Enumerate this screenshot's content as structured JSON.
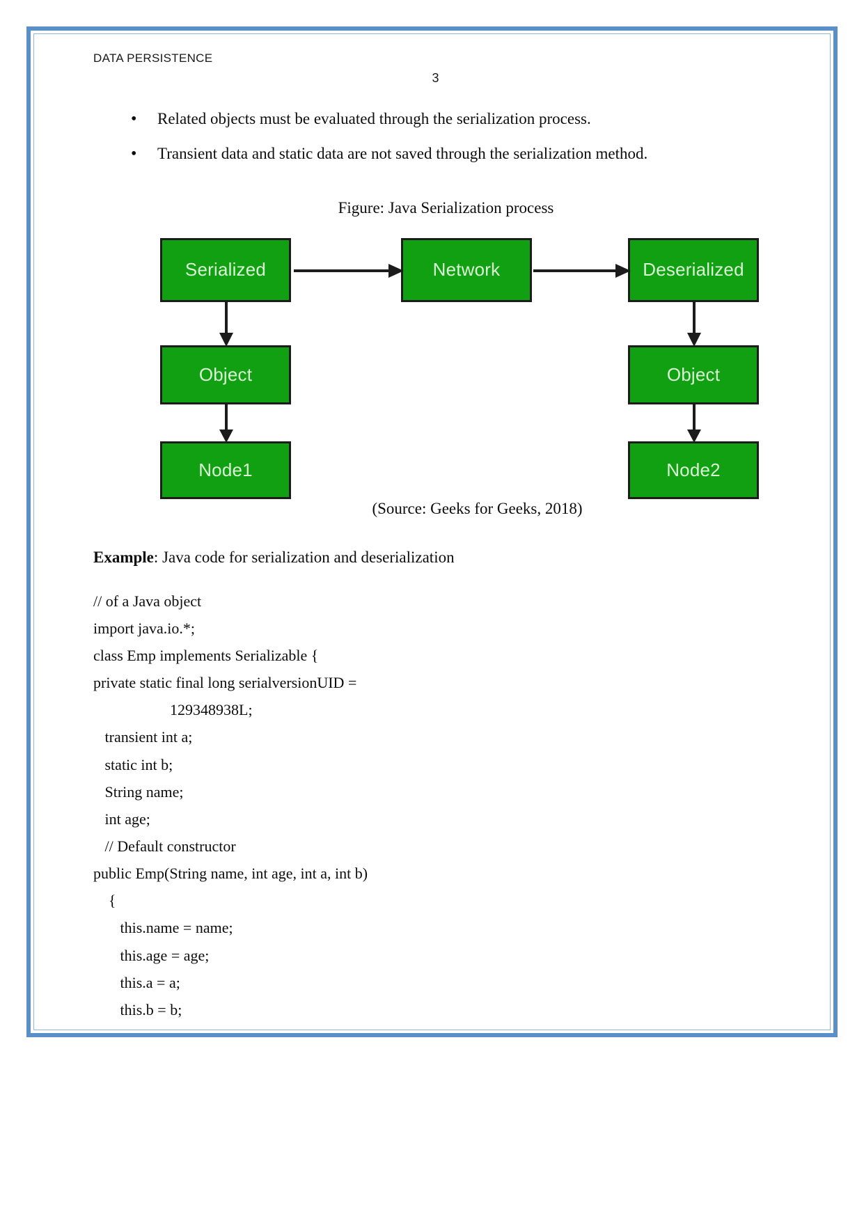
{
  "document": {
    "header": "DATA PERSISTENCE",
    "page_number": "3"
  },
  "bullets": [
    {
      "marker": "•",
      "text": "Related objects must be evaluated through the serialization process."
    },
    {
      "marker": "•",
      "text": "Transient data and static data are not saved through the serialization method."
    }
  ],
  "figure": {
    "caption": "Figure: Java Serialization process",
    "source": "(Source: Geeks for Geeks, 2018)",
    "box_fill": "#10a011",
    "box_border": "#1c1c1c",
    "box_text_color": "#d9f5d6",
    "nodes": {
      "serialized": "Serialized",
      "network": "Network",
      "deserialized": "Deserialized",
      "object_left": "Object",
      "object_right": "Object",
      "node1": "Node1",
      "node2": "Node2"
    }
  },
  "example": {
    "label": "Example",
    "rest": ": Java code for serialization and deserialization"
  },
  "code": {
    "lines": [
      "// of a Java object",
      "import java.io.*;",
      "class Emp implements Serializable {",
      "private static final long serialversionUID =",
      "                    129348938L;",
      "   transient int a;",
      "   static int b;",
      "   String name;",
      "   int age;",
      "   // Default constructor",
      "public Emp(String name, int age, int a, int b)",
      "    {",
      "       this.name = name;",
      "       this.age = age;",
      "       this.a = a;",
      "       this.b = b;"
    ]
  },
  "colors": {
    "page_border": "#5b8fc7",
    "page_border_inner": "#8fb4d9",
    "text": "#0d0d0d"
  }
}
